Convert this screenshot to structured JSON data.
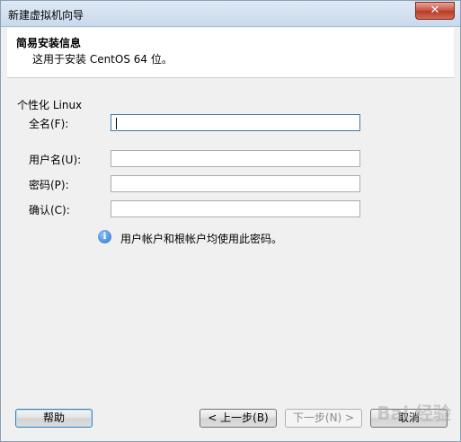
{
  "window": {
    "title": "新建虚拟机向导",
    "close_glyph": "✕"
  },
  "header": {
    "title": "简易安装信息",
    "subtitle": "这用于安装 CentOS 64 位。"
  },
  "form": {
    "group_label": "个性化 Linux",
    "fullname": {
      "label": "全名(F):",
      "value": ""
    },
    "username": {
      "label": "用户名(U):",
      "value": ""
    },
    "password": {
      "label": "密码(P):",
      "value": ""
    },
    "confirm": {
      "label": "确认(C):",
      "value": ""
    },
    "info_text": "用户帐户和根帐户均使用此密码。"
  },
  "footer": {
    "help": "帮助",
    "back": "< 上一步(B)",
    "next": "下一步(N) >",
    "cancel": "取消"
  },
  "watermark": "Bai 经验"
}
